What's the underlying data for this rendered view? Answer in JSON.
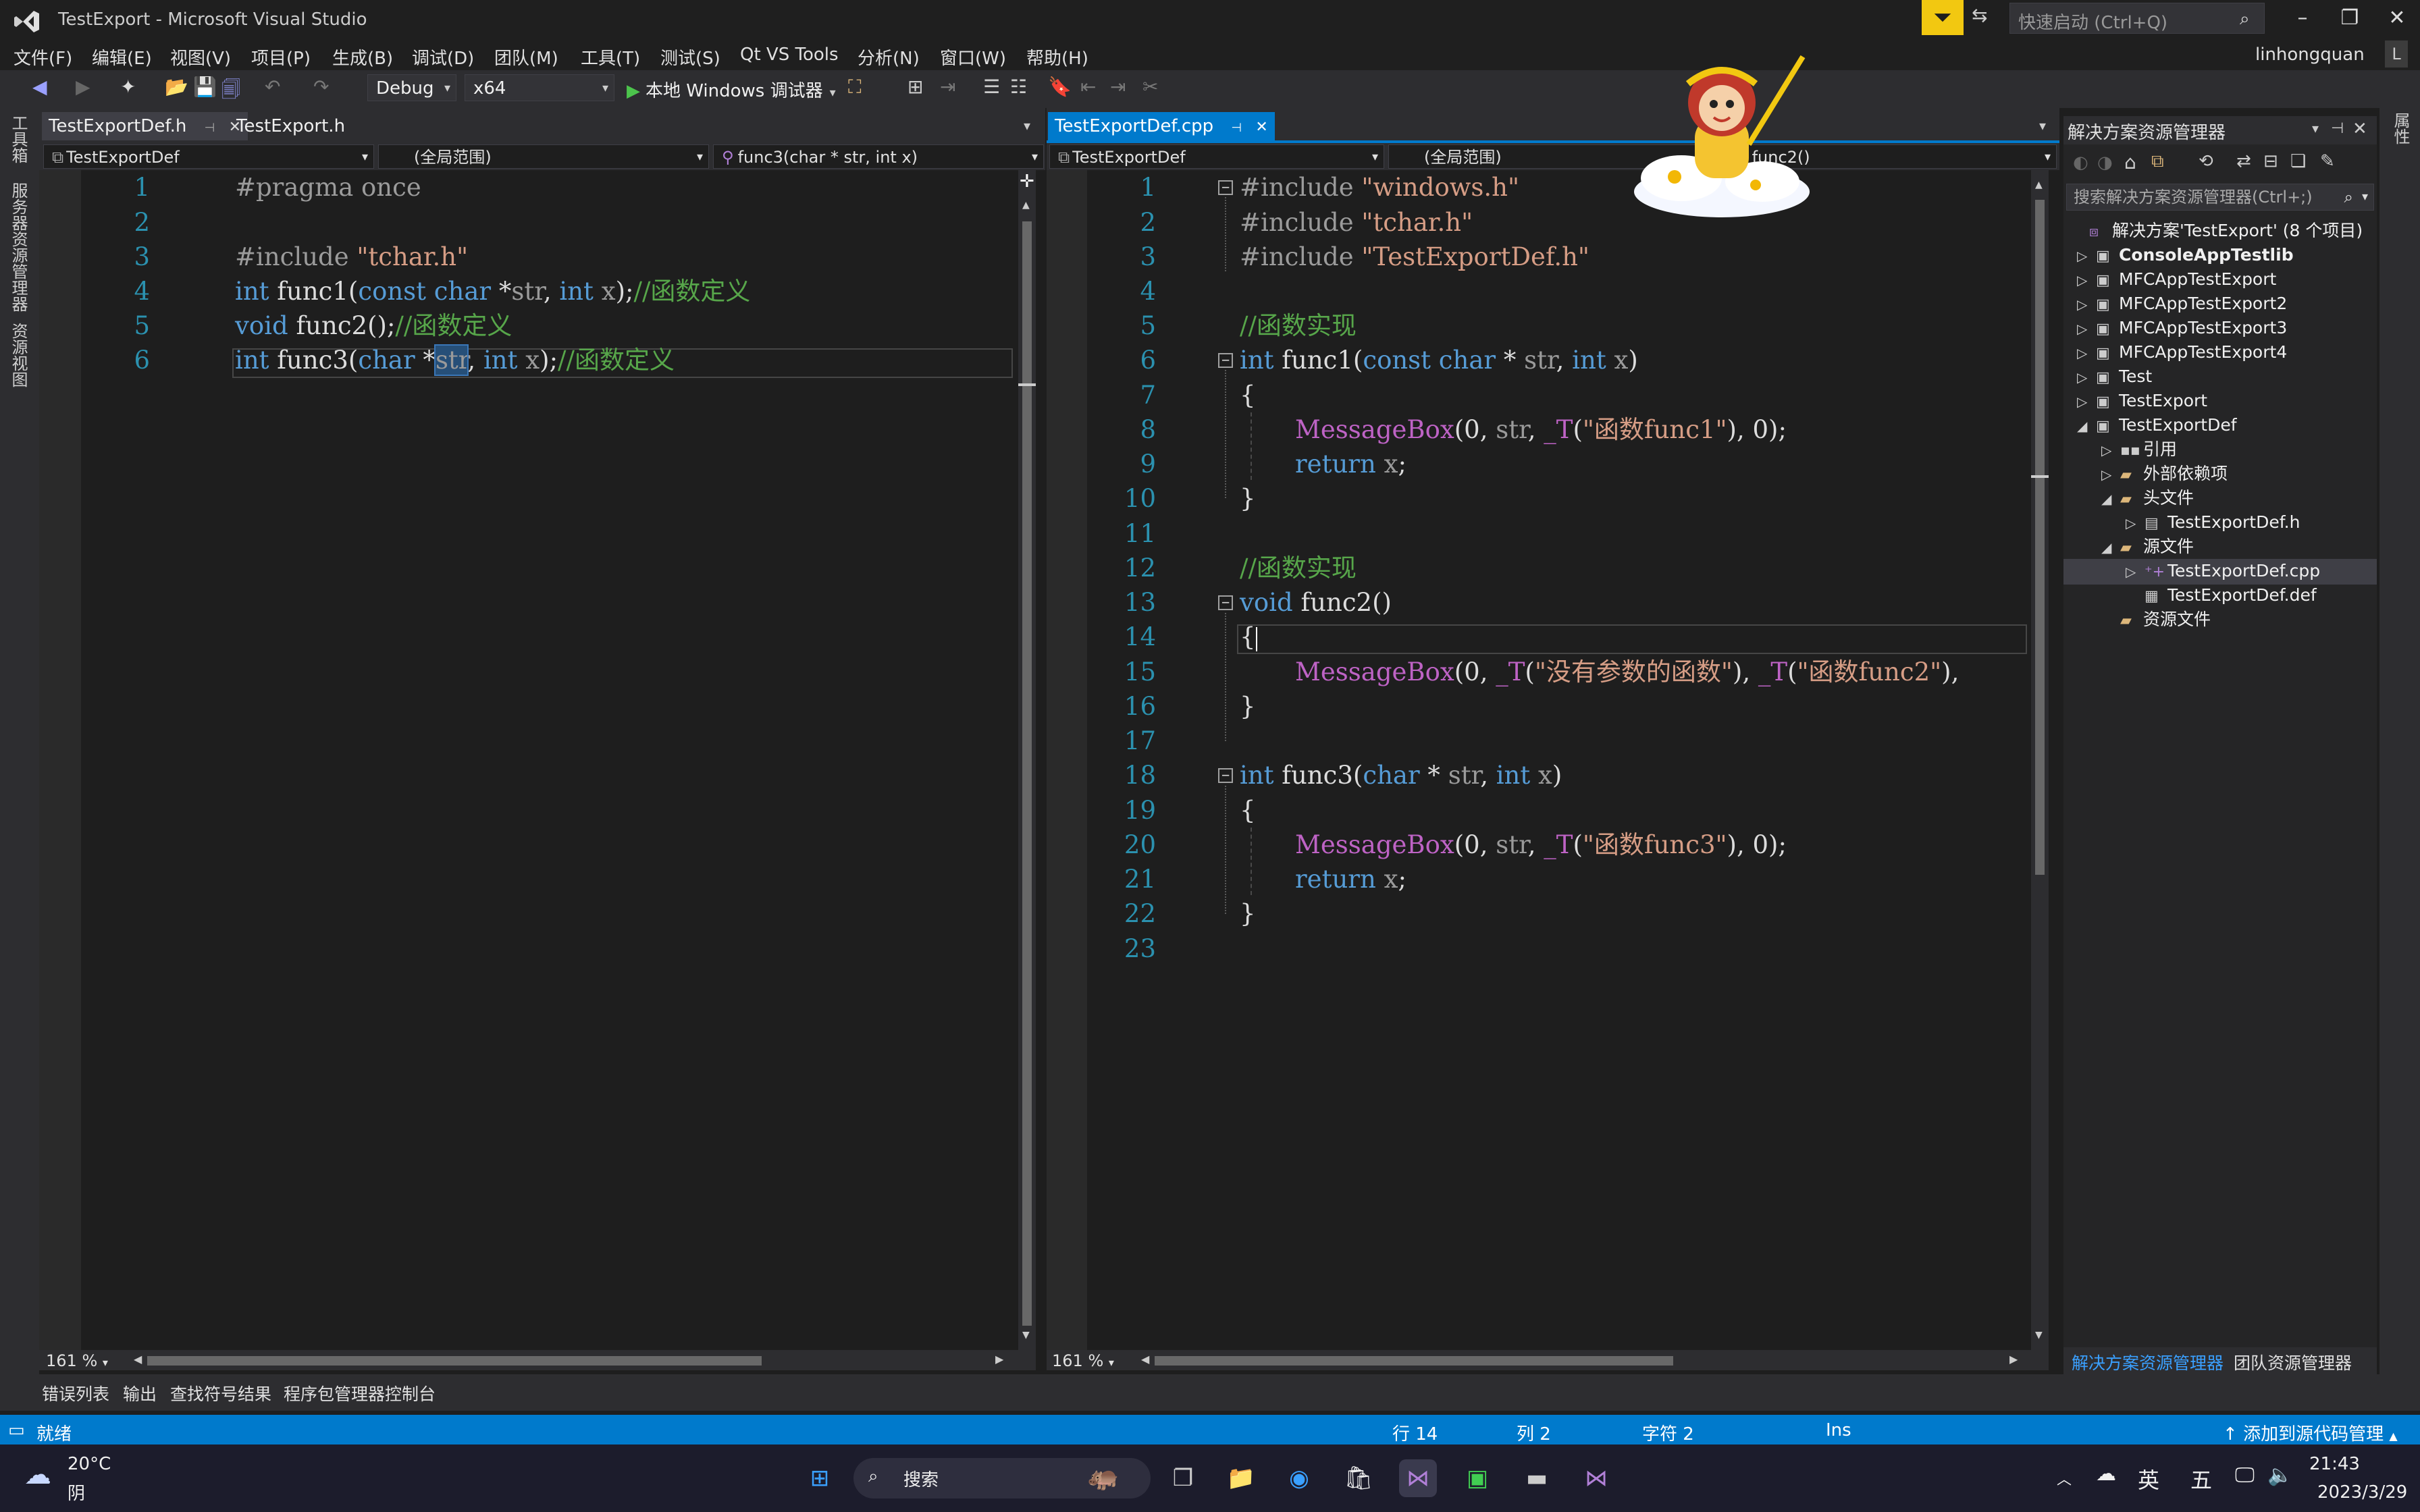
{
  "window": {
    "title": "TestExport - Microsoft Visual Studio",
    "quick_launch_placeholder": "快速启动 (Ctrl+Q)",
    "user": "linhongquan"
  },
  "menu": [
    "文件(F)",
    "编辑(E)",
    "视图(V)",
    "项目(P)",
    "生成(B)",
    "调试(D)",
    "团队(M)",
    "工具(T)",
    "测试(S)",
    "Qt VS Tools",
    "分析(N)",
    "窗口(W)",
    "帮助(H)"
  ],
  "toolbar": {
    "config": "Debug",
    "platform": "x64",
    "run_label": "本地 Windows 调试器"
  },
  "left_strip": [
    "工具箱",
    "服务器资源管理器",
    "资源视图"
  ],
  "right_strip": [
    "属性"
  ],
  "left_pane": {
    "tabs": [
      "TestExportDef.h",
      "TestExport.h"
    ],
    "nav": [
      "TestExportDef",
      "(全局范围)",
      "func3(char * str, int x)"
    ],
    "zoom": "161 %",
    "line_numbers": [
      "1",
      "2",
      "3",
      "4",
      "5",
      "6"
    ],
    "lines": {
      "l1": "#pragma once",
      "l3_pp": "#include ",
      "l3_str": "\"tchar.h\"",
      "l4_kw1": "int",
      "l4_fn": " func1(",
      "l4_kw2": "const",
      "l4_kw3": " char",
      "l4_p1": " *",
      "l4_par1": "str",
      "l4_p2": ", ",
      "l4_kw4": "int",
      "l4_par2": " x",
      "l4_p3": ");",
      "l4_cm": "//函数定义",
      "l5_kw": "void",
      "l5_fn": " func2();",
      "l5_cm": "//函数定义",
      "l6_kw1": "int",
      "l6_fn": " func3(",
      "l6_kw2": "char",
      "l6_p1": " *",
      "l6_sel": "str",
      "l6_p2": ", ",
      "l6_kw3": "int",
      "l6_par": " x",
      "l6_p3": ");",
      "l6_cm": "//函数定义"
    }
  },
  "right_pane": {
    "tabs": [
      "TestExportDef.cpp"
    ],
    "nav": [
      "TestExportDef",
      "(全局范围)",
      "func2()"
    ],
    "zoom": "161 %",
    "line_numbers": [
      "1",
      "2",
      "3",
      "4",
      "5",
      "6",
      "7",
      "8",
      "9",
      "10",
      "11",
      "12",
      "13",
      "14",
      "15",
      "16",
      "17",
      "18",
      "19",
      "20",
      "21",
      "22",
      "23"
    ],
    "lines": {
      "inc1_pp": "#include ",
      "inc1_str": "\"windows.h\"",
      "inc2_pp": "#include ",
      "inc2_str": "\"tchar.h\"",
      "inc3_pp": "#include ",
      "inc3_str": "\"TestExportDef.h\"",
      "c5": "//函数实现",
      "f1_kw": "int",
      "f1_fn": " func1(",
      "f1_kw2": "const",
      "f1_kw3": " char",
      "f1_p1": " * ",
      "f1_par": "str",
      "f1_p2": ", ",
      "f1_kw4": "int",
      "f1_par2": " x",
      "f1_p3": ")",
      "brace_open": "{",
      "brace_close": "}",
      "mb1_mac": "MessageBox",
      "mb1_a": "(0, ",
      "mb1_par": "str",
      "mb1_b": ", ",
      "mb1_t": "_T",
      "mb1_c": "(",
      "mb1_str": "\"函数func1\"",
      "mb1_d": "), 0);",
      "ret_kw": "return",
      "ret_par": " x",
      "ret_end": ";",
      "c12": "//函数实现",
      "f2_kw": "void",
      "f2_fn": " func2()",
      "mb2_mac": "MessageBox",
      "mb2_a": "(0, ",
      "mb2_t": "_T",
      "mb2_b": "(",
      "mb2_str": "\"没有参数的函数\"",
      "mb2_c": "), ",
      "mb2_t2": "_T",
      "mb2_d": "(",
      "mb2_str2": "\"函数func2\"",
      "mb2_e": "),",
      "f3_kw": "int",
      "f3_fn": " func3(",
      "f3_kw2": "char",
      "f3_p1": " * ",
      "f3_par": "str",
      "f3_p2": ", ",
      "f3_kw3": "int",
      "f3_par2": " x",
      "f3_p3": ")",
      "mb3_mac": "MessageBox",
      "mb3_a": "(0, ",
      "mb3_par": "str",
      "mb3_b": ", ",
      "mb3_t": "_T",
      "mb3_c": "(",
      "mb3_str": "\"函数func3\"",
      "mb3_d": "), 0);"
    }
  },
  "solution_explorer": {
    "title": "解决方案资源管理器",
    "search_placeholder": "搜索解决方案资源管理器(Ctrl+;)",
    "solution": "解决方案'TestExport' (8 个项目)",
    "nodes": [
      "ConsoleAppTestlib",
      "MFCAppTestExport",
      "MFCAppTestExport2",
      "MFCAppTestExport3",
      "MFCAppTestExport4",
      "Test",
      "TestExport",
      "TestExportDef",
      "引用",
      "外部依赖项",
      "头文件",
      "TestExportDef.h",
      "源文件",
      "TestExportDef.cpp",
      "TestExportDef.def",
      "资源文件"
    ],
    "bottom_tabs": [
      "解决方案资源管理器",
      "团队资源管理器"
    ]
  },
  "bottom_tabs": [
    "错误列表",
    "输出",
    "查找符号结果",
    "程序包管理器控制台"
  ],
  "status": {
    "ready": "就绪",
    "row": "行 14",
    "col": "列 2",
    "char": "字符 2",
    "ins": "Ins",
    "source_control": "添加到源代码管理"
  },
  "taskbar": {
    "temperature": "20°C",
    "weather": "阴",
    "search": "搜索",
    "ime1": "英",
    "ime2": "五",
    "time": "21:43",
    "date": "2023/3/29"
  },
  "colors": {
    "accent": "#007acc",
    "keyword": "#569cd6",
    "string": "#d69d85",
    "comment": "#57a64a",
    "line_number": "#2b91af",
    "macro": "#be63c5"
  }
}
